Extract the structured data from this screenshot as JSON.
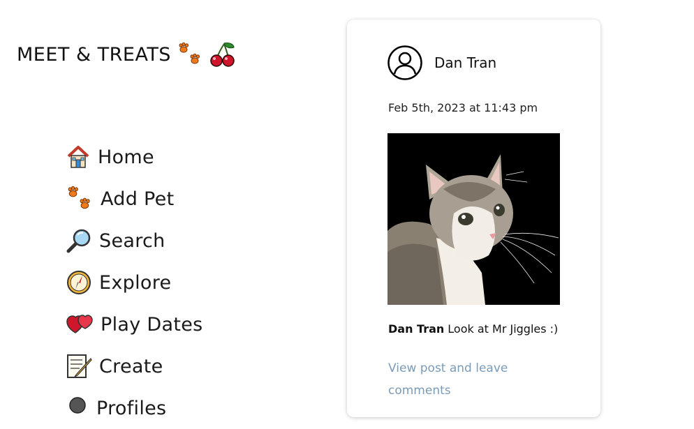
{
  "brand": {
    "title": "MEET & TREATS",
    "icons": [
      "paw-prints-icon",
      "cherries-icon"
    ]
  },
  "nav": [
    {
      "label": "Home",
      "icon": "house-icon"
    },
    {
      "label": "Add Pet",
      "icon": "paw-prints-icon"
    },
    {
      "label": "Search",
      "icon": "magnifier-icon"
    },
    {
      "label": "Explore",
      "icon": "compass-icon"
    },
    {
      "label": "Play Dates",
      "icon": "hearts-icon"
    },
    {
      "label": "Create",
      "icon": "memo-icon"
    },
    {
      "label": "Profiles",
      "icon": "person-icon"
    }
  ],
  "post": {
    "author": "Dan Tran",
    "timestamp": "Feb 5th, 2023 at 11:43 pm",
    "caption_author": "Dan Tran",
    "caption_text": "Look at Mr Jiggles :)",
    "link": "View post and leave comments",
    "image": "cat-photo"
  },
  "colors": {
    "link": "#7a9bb8",
    "paw": "#f07a1a",
    "cherry": "#d0162a",
    "background": "#ffffff"
  }
}
